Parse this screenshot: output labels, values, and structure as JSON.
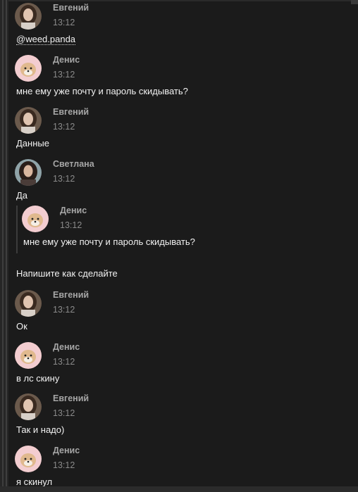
{
  "messages": [
    {
      "author": "Евгений",
      "time": "13:12",
      "avatar": "girl-avatar",
      "text": "",
      "mention": "@weed.panda"
    },
    {
      "author": "Денис",
      "time": "13:12",
      "avatar": "dog-avatar",
      "text": "мне ему уже почту и пароль скидывать?"
    },
    {
      "author": "Евгений",
      "time": "13:12",
      "avatar": "girl-avatar",
      "text": "Данные"
    },
    {
      "author": "Светлана",
      "time": "13:12",
      "avatar": "woman-avatar",
      "text": "Да"
    },
    {
      "author": "Евгений",
      "time": "13:12",
      "avatar": "girl-avatar",
      "text": "Ок"
    },
    {
      "author": "Денис",
      "time": "13:12",
      "avatar": "dog-avatar",
      "text": "в лс скину"
    },
    {
      "author": "Евгений",
      "time": "13:12",
      "avatar": "girl-avatar",
      "text": "Так и надо)"
    },
    {
      "author": "Денис",
      "time": "13:12",
      "avatar": "dog-avatar",
      "text": "я скинул"
    }
  ],
  "quote": {
    "author": "Денис",
    "time": "13:12",
    "avatar": "dog-avatar",
    "text": "мне ему уже почту и пароль скидывать?",
    "reply": "Напишите как сделайте"
  },
  "colors": {
    "background": "#1b1b1b",
    "author": "#a6a6a6",
    "time": "#8a8a8a",
    "text": "#f2f2f2"
  }
}
